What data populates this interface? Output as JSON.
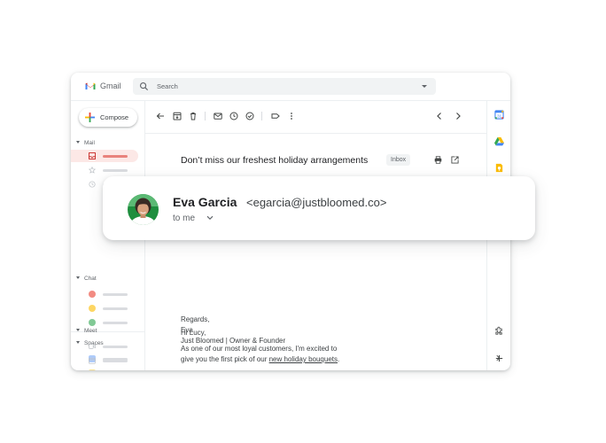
{
  "app": {
    "title": "Gmail",
    "search_placeholder": "Search",
    "compose_label": "Compose"
  },
  "sidebar": {
    "sections": {
      "mail": "Mail",
      "chat": "Chat",
      "spaces": "Spaces",
      "meet": "Meet"
    }
  },
  "email": {
    "subject": "Don’t miss our freshest holiday arrangements",
    "label": "Inbox",
    "greeting": "Hi Lucy,",
    "line1": "As one of our most loyal customers, I'm excited to",
    "line2_pre": "give you the first pick of our ",
    "line2_link": "new holiday bouquets",
    "line2_post": ".",
    "signoff": "Regards,",
    "sig_name": "Eva",
    "sig_title": "Just Bloomed | Owner & Founder"
  },
  "sender": {
    "name": "Eva Garcia",
    "email": "<egarcia@justbloomed.co>",
    "recipient": "to me"
  },
  "colors": {
    "gmail_red": "#ea4335",
    "blue": "#4285f4",
    "yellow": "#fbbc04",
    "green": "#34a853",
    "active_bg": "#fce8e6"
  }
}
